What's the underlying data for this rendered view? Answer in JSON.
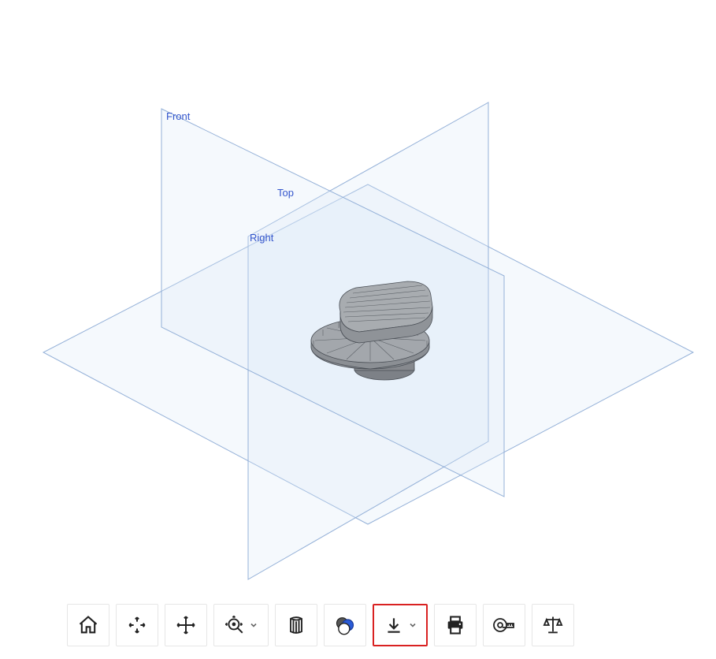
{
  "planes": {
    "front_label": "Front",
    "top_label": "Top",
    "right_label": "Right"
  },
  "toolbar": {
    "home": "Home view",
    "pan": "Fit / Pan",
    "move": "Move",
    "zoom": "Zoom",
    "section": "Section view",
    "appearance": "Appearance",
    "download": "Download",
    "print": "Print",
    "measure": "Measure",
    "mass": "Mass properties"
  },
  "colors": {
    "plane_fill": "#dce8f7",
    "plane_stroke": "#8aa8d4",
    "label": "#3355cc",
    "icon": "#222222",
    "icon_accent": "#2a5bd7",
    "highlight": "#d92121"
  }
}
